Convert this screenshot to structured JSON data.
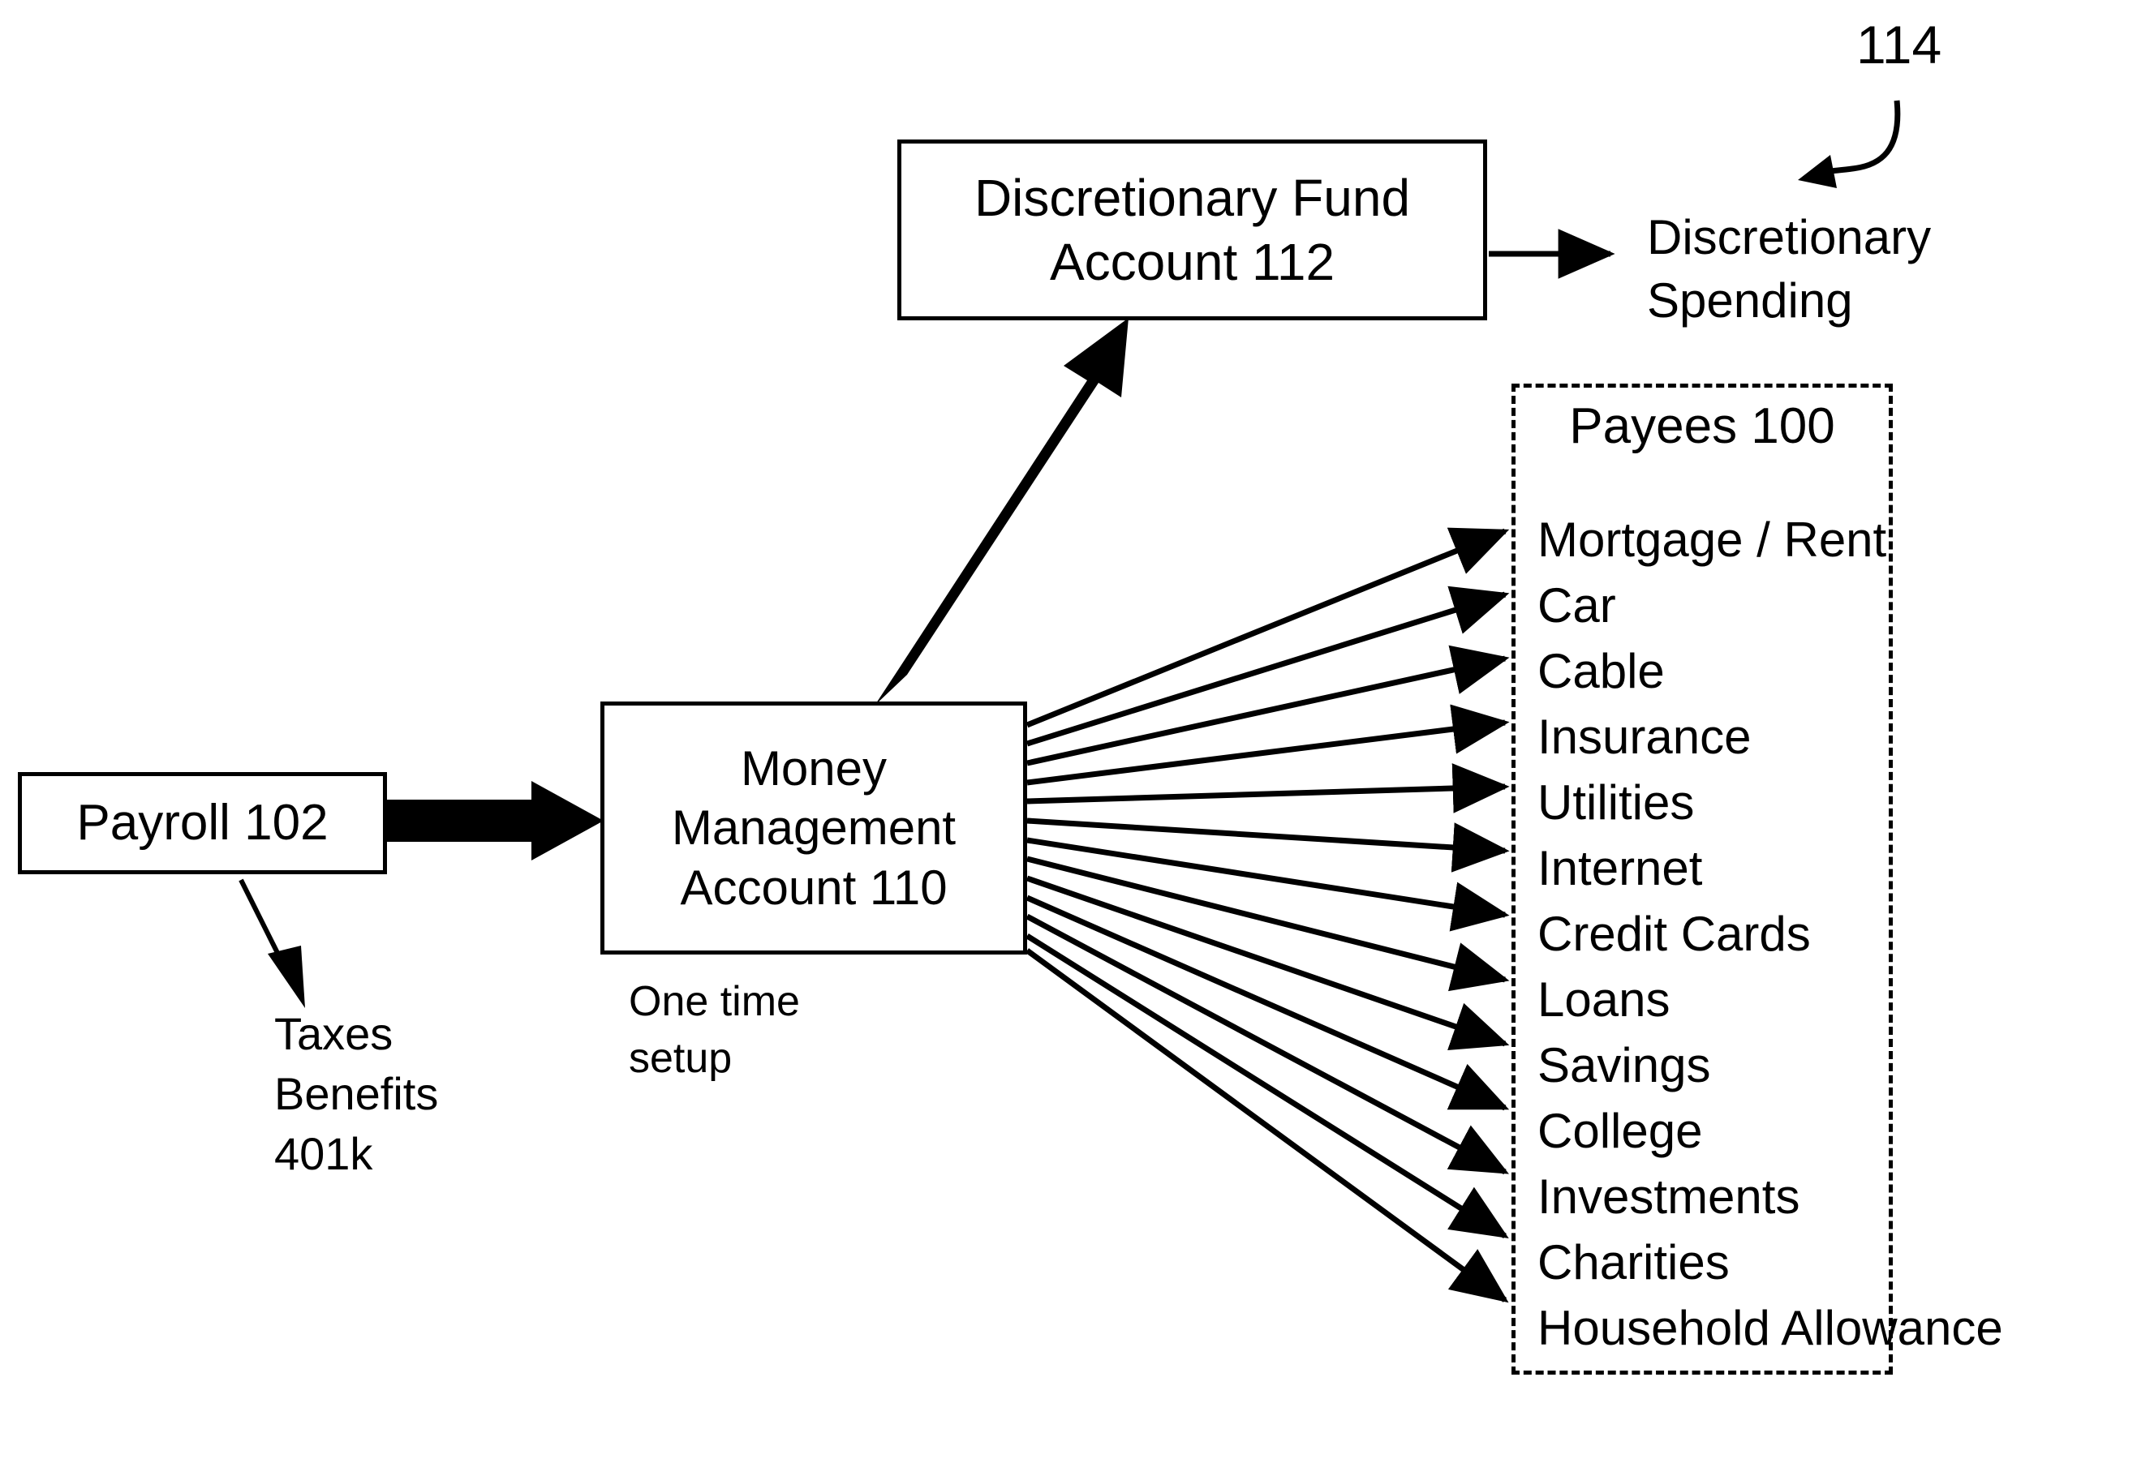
{
  "diagram": {
    "figure_reference": "114",
    "nodes": {
      "discretionary_fund": {
        "line1": "Discretionary Fund",
        "line2": "Account 112"
      },
      "money_management": {
        "line1": "Money",
        "line2": "Management",
        "line3": "Account 110"
      },
      "payroll": {
        "label": "Payroll 102"
      }
    },
    "annotations": {
      "one_time_setup": [
        "One time",
        "setup"
      ],
      "payroll_deductions": [
        "Taxes",
        "Benefits",
        "401k"
      ],
      "discretionary_spending": [
        "Discretionary",
        "Spending"
      ]
    },
    "payees_group": {
      "title": "Payees 100",
      "items": [
        "Mortgage / Rent",
        "Car",
        "Cable",
        "Insurance",
        "Utilities",
        "Internet",
        "Credit Cards",
        "Loans",
        "Savings",
        "College",
        "Investments",
        "Charities",
        "Household Allowance"
      ]
    },
    "colors": {
      "stroke": "#000000",
      "background": "#ffffff"
    }
  }
}
